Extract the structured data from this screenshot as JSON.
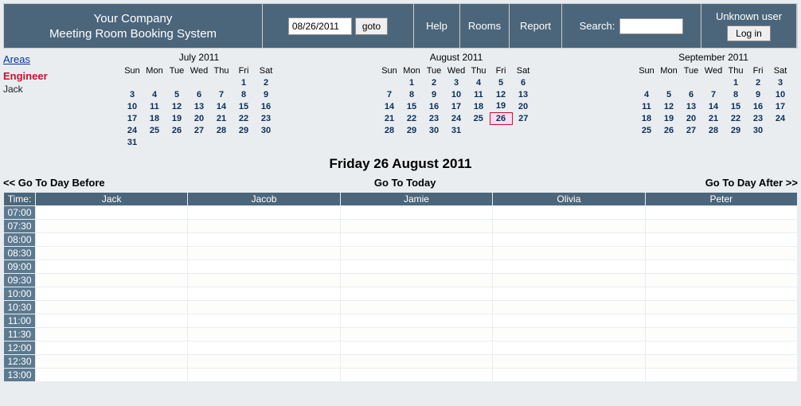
{
  "brand": {
    "line1": "Your Company",
    "line2": "Meeting Room Booking System"
  },
  "goto": {
    "date": "08/26/2011",
    "button": "goto"
  },
  "nav": {
    "help": "Help",
    "rooms": "Rooms",
    "report": "Report"
  },
  "search": {
    "label": "Search:"
  },
  "auth": {
    "user": "Unknown user",
    "login": "Log in"
  },
  "areas": {
    "header": "Areas",
    "selected": "Engineer",
    "room": "Jack"
  },
  "dow": [
    "Sun",
    "Mon",
    "Tue",
    "Wed",
    "Thu",
    "Fri",
    "Sat"
  ],
  "cal_prev": {
    "title": "July 2011",
    "weeks": [
      [
        "",
        "",
        "",
        "",
        "",
        "1",
        "2"
      ],
      [
        "3",
        "4",
        "5",
        "6",
        "7",
        "8",
        "9"
      ],
      [
        "10",
        "11",
        "12",
        "13",
        "14",
        "15",
        "16"
      ],
      [
        "17",
        "18",
        "19",
        "20",
        "21",
        "22",
        "23"
      ],
      [
        "24",
        "25",
        "26",
        "27",
        "28",
        "29",
        "30"
      ],
      [
        "31",
        "",
        "",
        "",
        "",
        "",
        ""
      ]
    ]
  },
  "cal_cur": {
    "title": "August 2011",
    "weeks": [
      [
        "",
        "1",
        "2",
        "3",
        "4",
        "5",
        "6"
      ],
      [
        "7",
        "8",
        "9",
        "10",
        "11",
        "12",
        "13"
      ],
      [
        "14",
        "15",
        "16",
        "17",
        "18",
        "19",
        "20"
      ],
      [
        "21",
        "22",
        "23",
        "24",
        "25",
        "26",
        "27"
      ],
      [
        "28",
        "29",
        "30",
        "31",
        "",
        "",
        ""
      ]
    ],
    "today": "26"
  },
  "cal_next": {
    "title": "September 2011",
    "weeks": [
      [
        "",
        "",
        "",
        "",
        "1",
        "2",
        "3"
      ],
      [
        "4",
        "5",
        "6",
        "7",
        "8",
        "9",
        "10"
      ],
      [
        "11",
        "12",
        "13",
        "14",
        "15",
        "16",
        "17"
      ],
      [
        "18",
        "19",
        "20",
        "21",
        "22",
        "23",
        "24"
      ],
      [
        "25",
        "26",
        "27",
        "28",
        "29",
        "30",
        ""
      ]
    ]
  },
  "dateheader": "Friday 26 August 2011",
  "daynav": {
    "prev": "<< Go To Day Before",
    "today": "Go To Today",
    "next": "Go To Day After >>"
  },
  "rooms": [
    "Jack",
    "Jacob",
    "Jamie",
    "Olivia",
    "Peter"
  ],
  "timecol": "Time:",
  "times": [
    "07:00",
    "07:30",
    "08:00",
    "08:30",
    "09:00",
    "09:30",
    "10:00",
    "10:30",
    "11:00",
    "11:30",
    "12:00",
    "12:30",
    "13:00"
  ]
}
